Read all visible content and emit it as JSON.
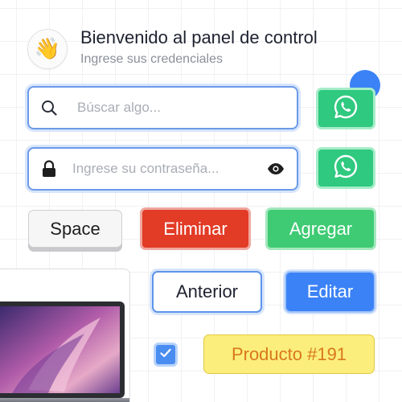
{
  "header": {
    "avatar_icon": "waving-hand-icon",
    "title": "Bienvenido al panel de control",
    "subtitle": "Ingrese sus credenciales"
  },
  "search": {
    "icon": "search-icon",
    "placeholder": "Búscar algo..."
  },
  "password": {
    "icon": "lock-icon",
    "placeholder": "Ingrese su contraseña...",
    "toggle_icon": "eye-icon"
  },
  "whatsapp_buttons": [
    {
      "icon": "whatsapp-icon"
    },
    {
      "icon": "whatsapp-icon"
    }
  ],
  "buttons": {
    "space": "Space",
    "eliminar": "Eliminar",
    "agregar": "Agregar",
    "anterior": "Anterior",
    "editar": "Editar"
  },
  "checkbox": {
    "checked": true
  },
  "product": {
    "label": "Producto #191"
  },
  "card": {
    "image": "laptop-image"
  },
  "colors": {
    "primary_blue": "#3b82f6",
    "whatsapp_green": "#2fc97f",
    "danger_red": "#e23b26",
    "success_green": "#3ecb73",
    "tag_yellow": "#fbee7d",
    "tag_text": "#d9781a"
  }
}
